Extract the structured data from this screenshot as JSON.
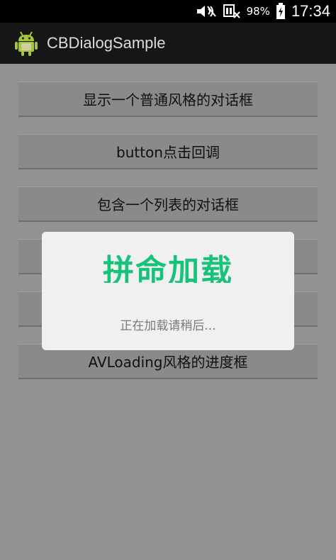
{
  "status_bar": {
    "battery_percent": "98%",
    "time": "17:34",
    "icons": [
      "mute-icon",
      "no-signal-icon",
      "battery-charging-icon"
    ]
  },
  "action_bar": {
    "title": "CBDialogSample",
    "icon": "android-icon"
  },
  "buttons": [
    {
      "label": "显示一个普通风格的对话框"
    },
    {
      "label": "button点击回调"
    },
    {
      "label": "包含一个列表的对话框"
    },
    {
      "label": ""
    },
    {
      "label": ""
    },
    {
      "label": "AVLoading风格的进度框"
    }
  ],
  "dialog": {
    "title": "拼命加载",
    "message": "正在加载请稍后..."
  },
  "colors": {
    "dialog_accent": "#17c37a",
    "dim_background": "#929292"
  }
}
